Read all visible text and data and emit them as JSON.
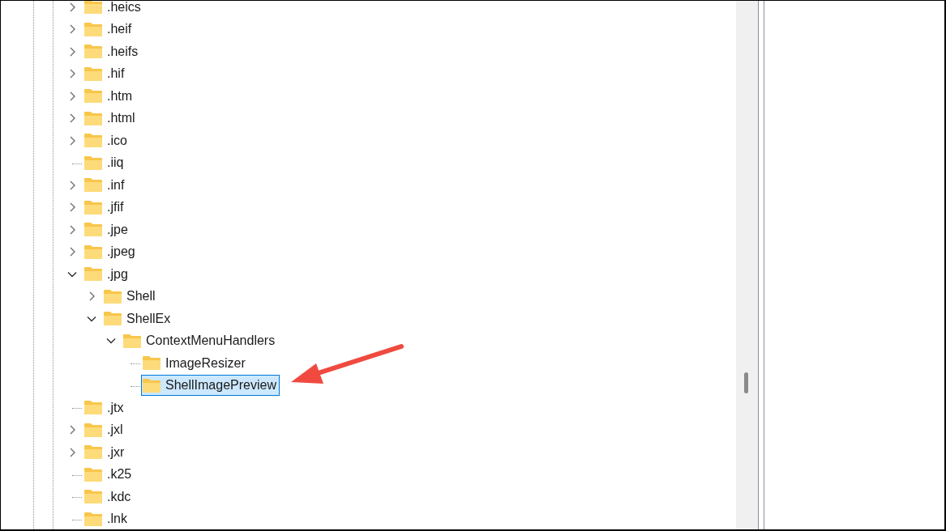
{
  "tree": {
    "items": [
      {
        "label": ".heics",
        "kind": "collapsed",
        "selected": false
      },
      {
        "label": ".heif",
        "kind": "collapsed",
        "selected": false
      },
      {
        "label": ".heifs",
        "kind": "collapsed",
        "selected": false
      },
      {
        "label": ".hif",
        "kind": "collapsed",
        "selected": false
      },
      {
        "label": ".htm",
        "kind": "collapsed",
        "selected": false
      },
      {
        "label": ".html",
        "kind": "collapsed",
        "selected": false
      },
      {
        "label": ".ico",
        "kind": "collapsed",
        "selected": false
      },
      {
        "label": ".iiq",
        "kind": "leaf",
        "selected": false
      },
      {
        "label": ".inf",
        "kind": "collapsed",
        "selected": false
      },
      {
        "label": ".jfif",
        "kind": "collapsed",
        "selected": false
      },
      {
        "label": ".jpe",
        "kind": "collapsed",
        "selected": false
      },
      {
        "label": ".jpeg",
        "kind": "collapsed",
        "selected": false
      },
      {
        "label": ".jpg",
        "kind": "expanded",
        "selected": false,
        "children": [
          {
            "label": "Shell",
            "kind": "collapsed",
            "selected": false
          },
          {
            "label": "ShellEx",
            "kind": "expanded",
            "selected": false,
            "children": [
              {
                "label": "ContextMenuHandlers",
                "kind": "expanded",
                "selected": false,
                "children": [
                  {
                    "label": "ImageResizer",
                    "kind": "leaf",
                    "selected": false
                  },
                  {
                    "label": "ShellImagePreview",
                    "kind": "leaf",
                    "selected": true
                  }
                ]
              }
            ]
          }
        ]
      },
      {
        "label": ".jtx",
        "kind": "leaf",
        "selected": false
      },
      {
        "label": ".jxl",
        "kind": "collapsed",
        "selected": false
      },
      {
        "label": ".jxr",
        "kind": "collapsed",
        "selected": false
      },
      {
        "label": ".k25",
        "kind": "leaf",
        "selected": false
      },
      {
        "label": ".kdc",
        "kind": "leaf",
        "selected": false
      },
      {
        "label": ".lnk",
        "kind": "leaf",
        "selected": false
      }
    ]
  }
}
